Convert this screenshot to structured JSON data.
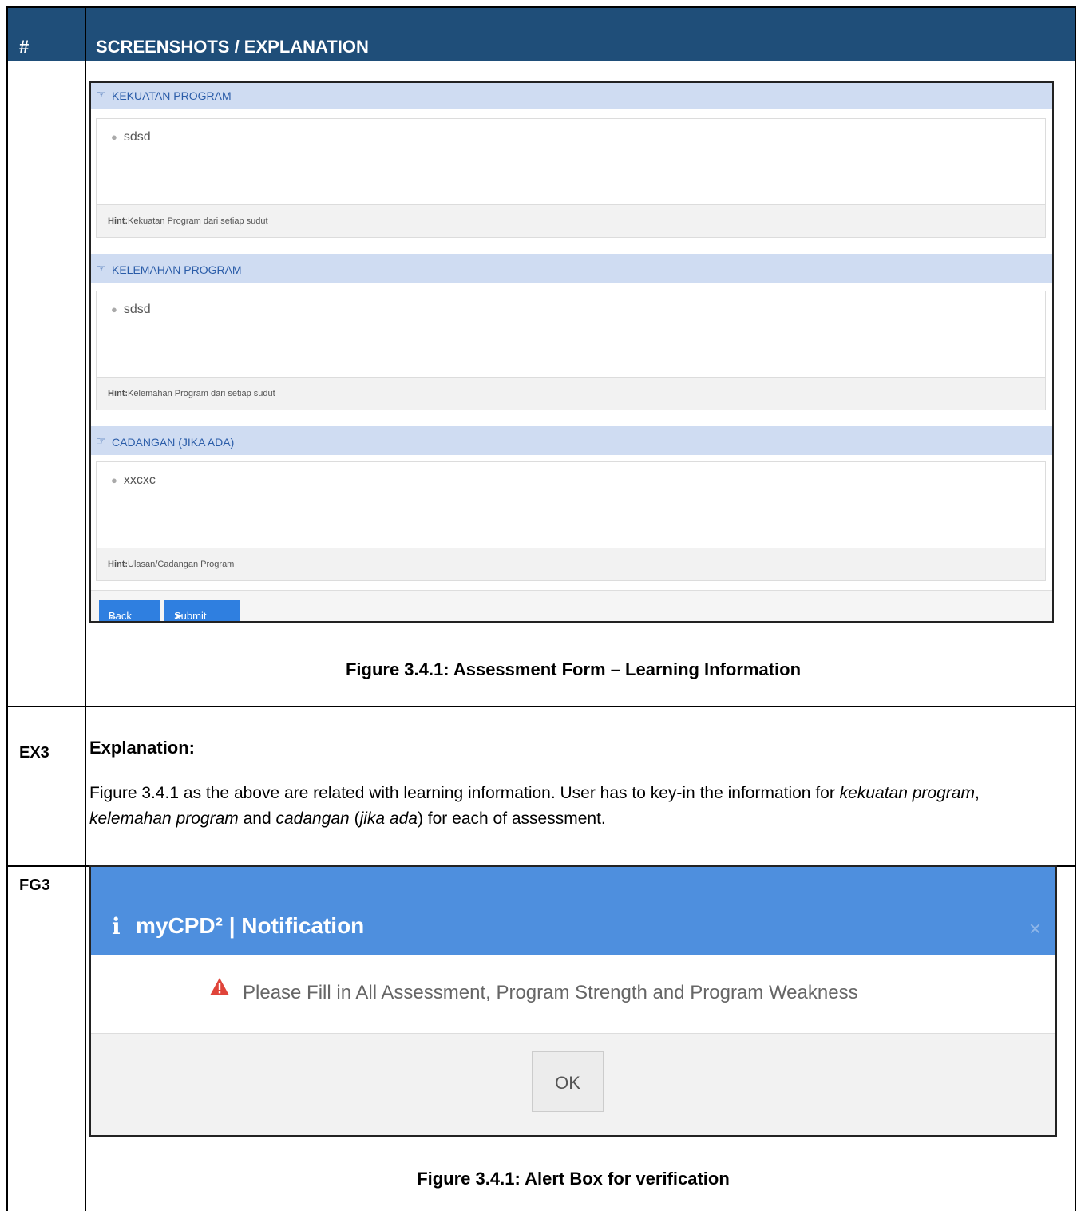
{
  "table_header": {
    "col1": "#",
    "col2": "SCREENSHOTS / EXPLANATION"
  },
  "rows": {
    "ex_label": "EX3",
    "fg_label": "FG3"
  },
  "form": {
    "sections": [
      {
        "title": "KEKUATAN PROGRAM",
        "value": "sdsd",
        "hint_label": "Hint:",
        "hint": "Kekuatan Program dari setiap sudut"
      },
      {
        "title": "KELEMAHAN PROGRAM",
        "value": "sdsd",
        "hint_label": "Hint:",
        "hint": "Kelemahan Program dari setiap sudut"
      },
      {
        "title": "CADANGAN (JIKA ADA)",
        "value": "xxcxc",
        "hint_label": "Hint:",
        "hint": "Ulasan/Cadangan Program"
      }
    ],
    "back_label": "Back",
    "submit_label": "Submit"
  },
  "caption1": "Figure 3.4.1: Assessment Form – Learning Information",
  "explanation": {
    "title": "Explanation:",
    "parts": {
      "p1": "Figure 3.4.1 as the above are related with learning information. User has to key-in the information for ",
      "i1": "kekuatan program",
      "p2": ", ",
      "i2": "kelemahan program",
      "p3": " and ",
      "i3": "cadangan",
      "p4": " (",
      "i4": "jika ada",
      "p5": ") for each of assessment."
    }
  },
  "modal": {
    "title": "myCPD² | Notification",
    "close": "×",
    "message": "Please Fill in All Assessment, Program Strength and Program Weakness",
    "ok_label": "OK"
  },
  "caption2": "Figure 3.4.1: Alert Box for verification",
  "colors": {
    "header_bg": "#1f4e79",
    "modal_head": "#4e8fde",
    "section_head": "#cfdcf2",
    "button": "#2f7fe0",
    "warning": "#e0443a"
  }
}
